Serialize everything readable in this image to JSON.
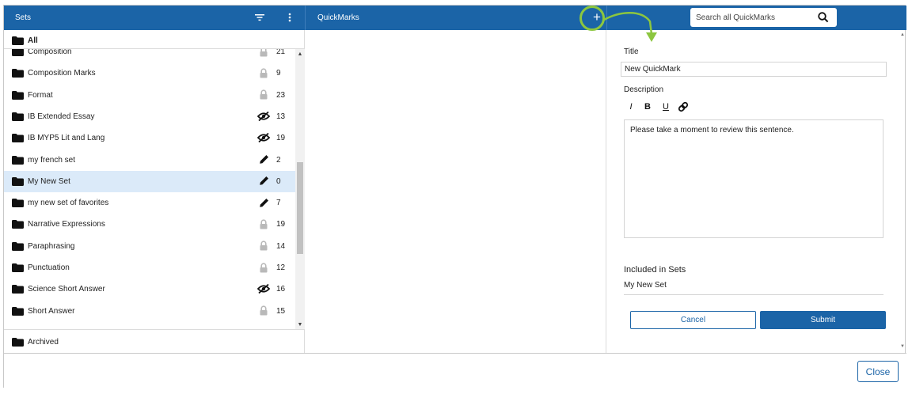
{
  "sets_panel": {
    "title": "Sets",
    "all_label": "All",
    "items": [
      {
        "label": "Composition",
        "status": "lock-icon",
        "count": "21"
      },
      {
        "label": "Composition Marks",
        "status": "lock-icon",
        "count": "9"
      },
      {
        "label": "Format",
        "status": "lock-icon",
        "count": "23"
      },
      {
        "label": "IB Extended Essay",
        "status": "eye-off-icon",
        "count": "13"
      },
      {
        "label": "IB MYP5 Lit and Lang",
        "status": "eye-off-icon",
        "count": "19"
      },
      {
        "label": "my french set",
        "status": "pencil-icon",
        "count": "2"
      },
      {
        "label": "My New Set",
        "status": "pencil-icon",
        "count": "0",
        "selected": true
      },
      {
        "label": "my new set of favorites",
        "status": "pencil-icon",
        "count": "7"
      },
      {
        "label": "Narrative Expressions",
        "status": "lock-icon",
        "count": "19"
      },
      {
        "label": "Paraphrasing",
        "status": "lock-icon",
        "count": "14"
      },
      {
        "label": "Punctuation",
        "status": "lock-icon",
        "count": "12"
      },
      {
        "label": "Science Short Answer",
        "status": "eye-off-icon",
        "count": "16"
      },
      {
        "label": "Short Answer",
        "status": "lock-icon",
        "count": "15"
      }
    ],
    "archived_label": "Archived"
  },
  "quickmarks_panel": {
    "title": "QuickMarks"
  },
  "search": {
    "placeholder": "Search all QuickMarks"
  },
  "editor": {
    "title_label": "Title",
    "title_value": "New QuickMark",
    "description_label": "Description",
    "format_buttons": [
      "I",
      "B",
      "U"
    ],
    "description_value": "Please take a moment to review this sentence.",
    "included_label": "Included in Sets",
    "included_value": "My New Set",
    "cancel_label": "Cancel",
    "submit_label": "Submit"
  },
  "footer": {
    "close_label": "Close"
  },
  "colors": {
    "header": "#1b64a7",
    "selected_row": "#dbeaf9",
    "annotation": "#8cc63f"
  }
}
